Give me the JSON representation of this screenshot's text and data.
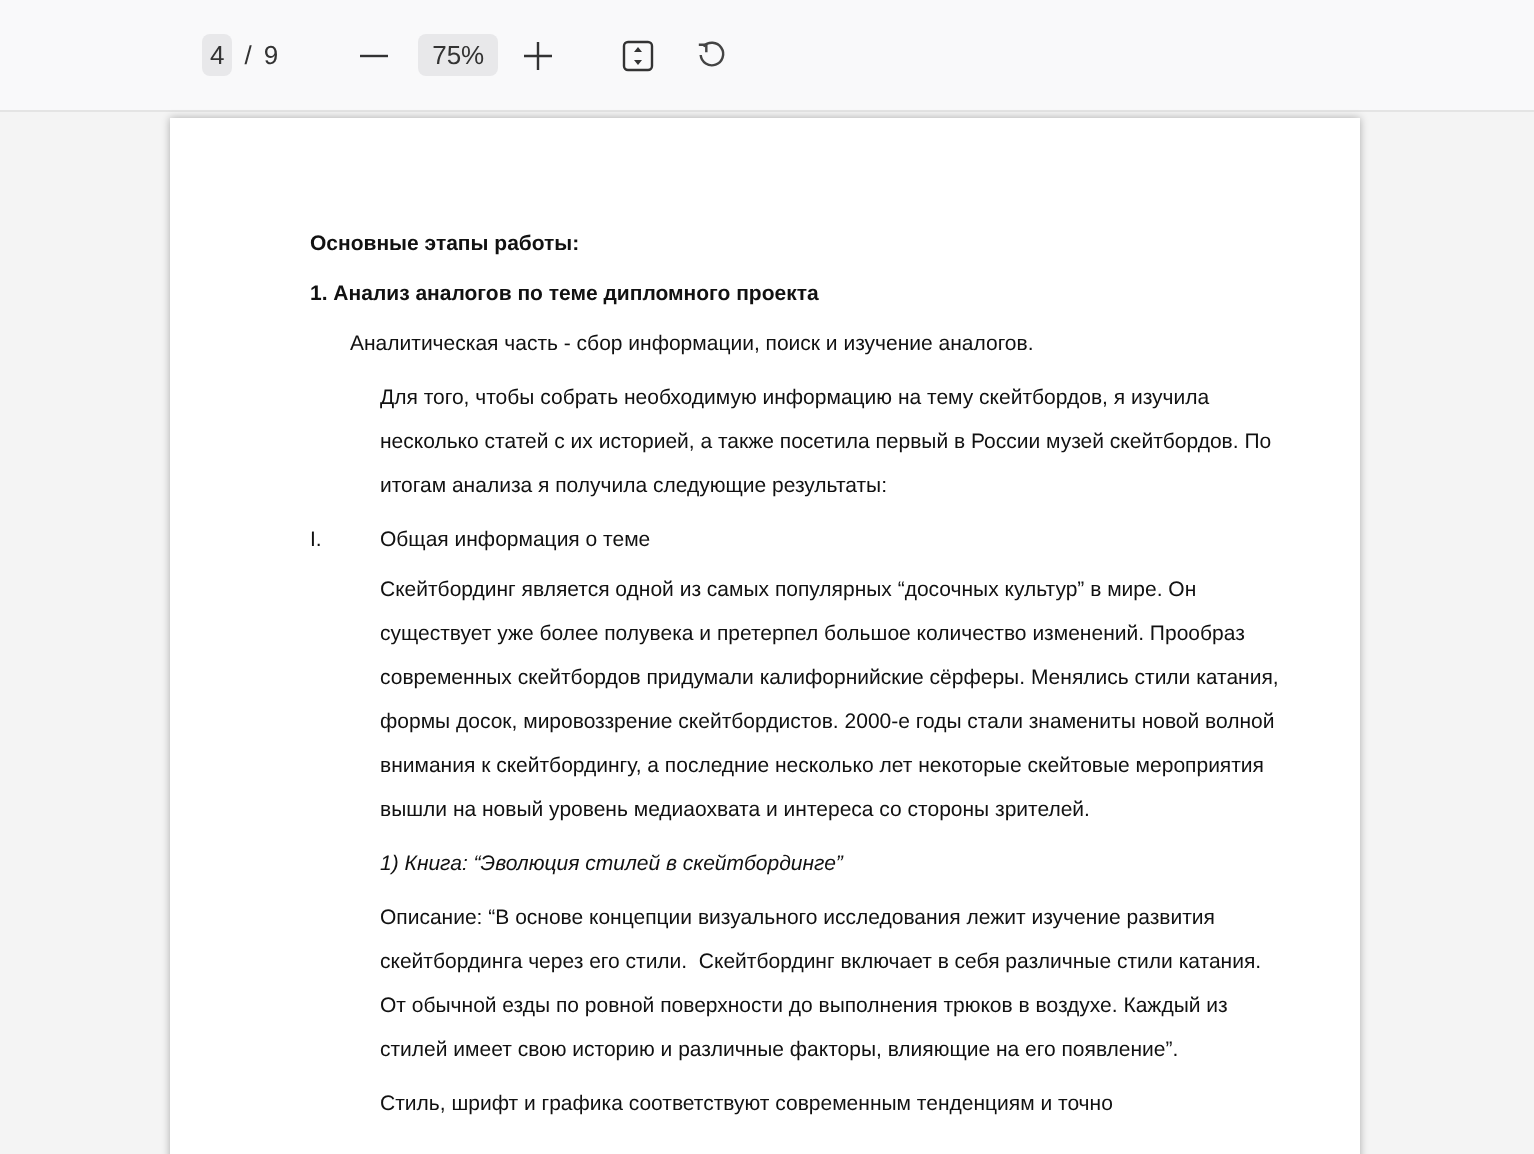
{
  "toolbar": {
    "page_current": "4",
    "page_separator": "/",
    "page_total": "9",
    "zoom": "75%"
  },
  "document": {
    "blocks": [
      {
        "kind": "heading",
        "text": "Основные этапы работы:"
      },
      {
        "kind": "heading",
        "text": "1. Анализ аналогов по теме дипломного  проекта"
      },
      {
        "kind": "lead",
        "text": "Аналитическая часть - сбор информации, поиск и изучение аналогов."
      },
      {
        "kind": "para",
        "text": "Для того, чтобы собрать необходимую информацию на тему скейтбордов, я изучила несколько статей с их историей, а также посетила первый в России музей скейтбордов. По итогам анализа я получила следующие результаты:"
      },
      {
        "kind": "list",
        "marker": "I.",
        "text": "Общая информация о теме"
      },
      {
        "kind": "para",
        "text": "Скейтбординг является одной из самых популярных “досочных культур” в мире. Он существует уже более полувека и претерпел большое количество изменений. Прообраз современных скейтбордов придумали калифорнийские сёрферы. Менялись стили катания, формы досок, мировоззрение скейтбордистов. 2000-е годы стали знамениты новой волной внимания к скейтбордингу, а последние несколько лет некоторые скейтовые мероприятия вышли на новый уровень медиаохвата и интереса со стороны зрителей."
      },
      {
        "kind": "italic",
        "text": "1) Книга: “Эволюция стилей в скейтбординге”"
      },
      {
        "kind": "para",
        "text": "Описание: “В основе концепции визуального исследования лежит изучение развития скейтбординга через его стили.  Скейтбординг включает в себя различные стили катания.  От обычной езды по ровной поверхности до выполнения трюков в воздухе. Каждый из стилей имеет свою историю и различные факторы, влияющие на его появление”."
      },
      {
        "kind": "para",
        "text": "Стиль, шрифт и графика соответствуют современным тенденциям и точно"
      }
    ]
  }
}
